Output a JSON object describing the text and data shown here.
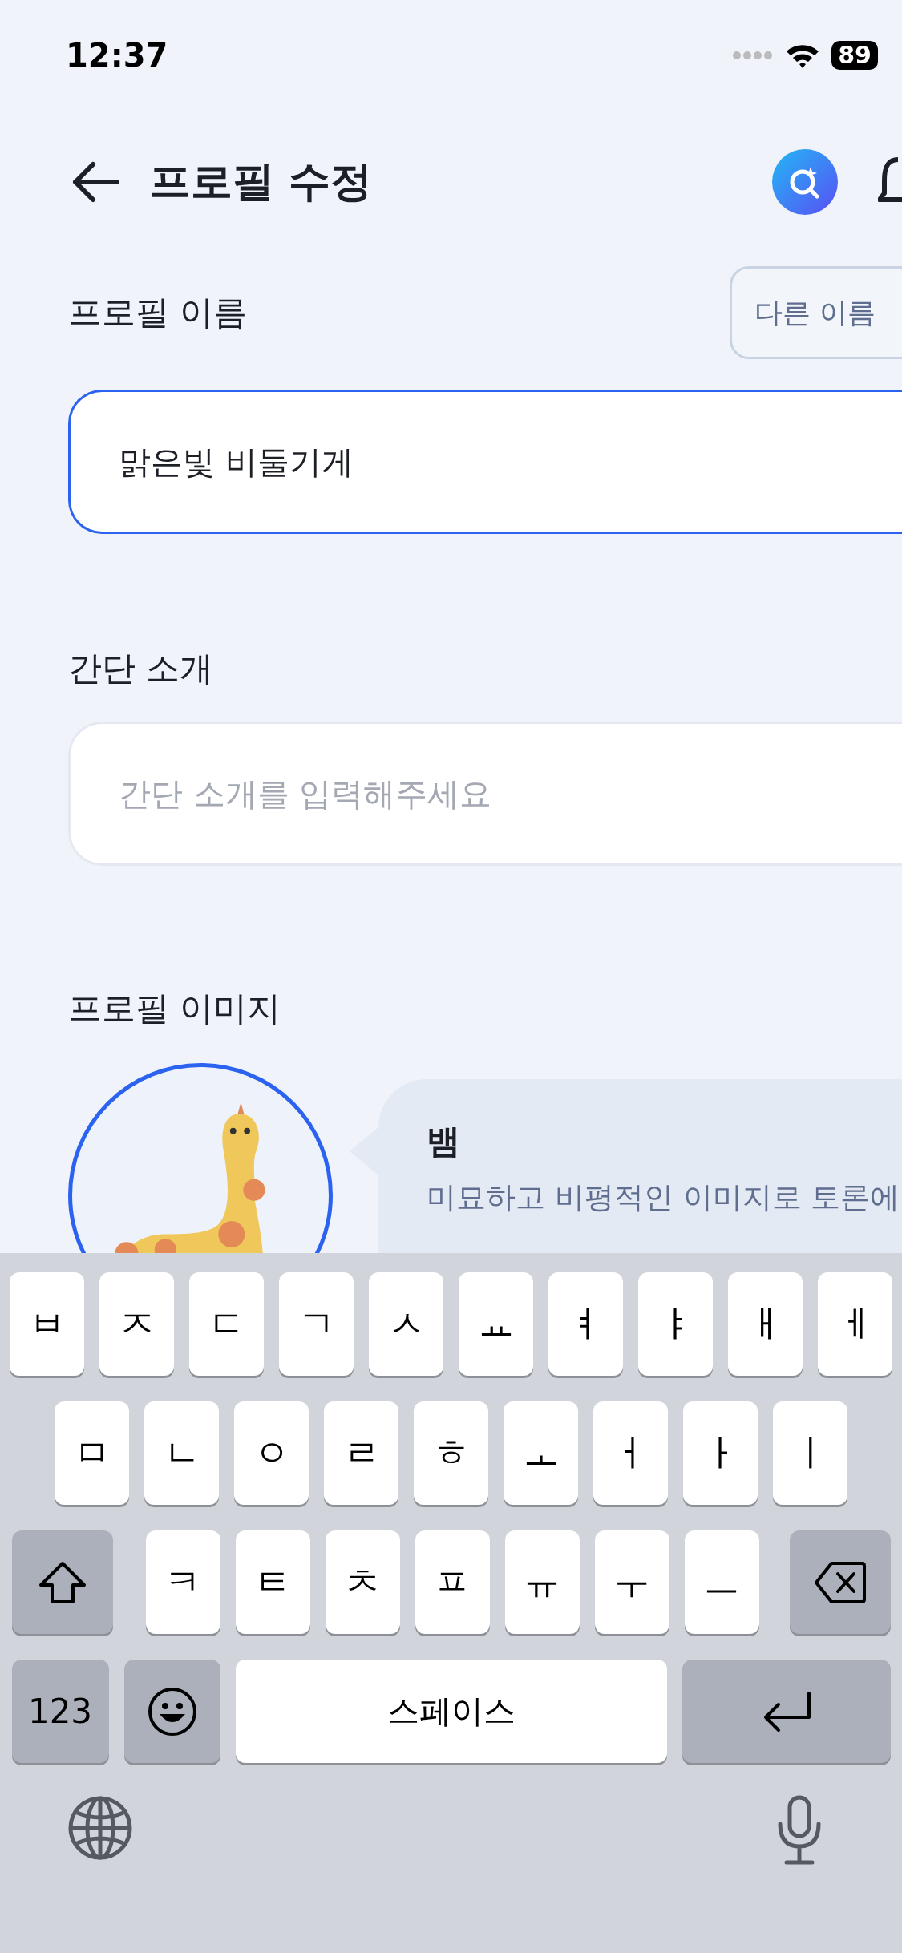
{
  "status_bar": {
    "time": "12:37",
    "battery": "89"
  },
  "header": {
    "title": "프로필 수정"
  },
  "name_section": {
    "label": "프로필 이름",
    "button": "다른 이름",
    "value": "맑은빛 비둘기게",
    "focused": true
  },
  "intro_section": {
    "label": "간단 소개",
    "placeholder": "간단 소개를 입력해주세요"
  },
  "image_section": {
    "label": "프로필 이미지",
    "character_name": "뱀",
    "description": [
      "미묘하고 비평적인 이미지로 토론에"
    ]
  },
  "keyboard": {
    "bottom_row": {
      "numbers_key": "123",
      "space_key": "스페이스"
    },
    "rows": [
      [
        {
          "kind": "letter",
          "label": "ㅂ"
        },
        {
          "kind": "letter",
          "label": "ㅈ"
        },
        {
          "kind": "letter",
          "label": "ㄷ"
        },
        {
          "kind": "letter",
          "label": "ㄱ"
        },
        {
          "kind": "letter",
          "label": "ㅅ"
        },
        {
          "kind": "letter",
          "label": "ㅛ"
        },
        {
          "kind": "letter",
          "label": "ㅕ"
        },
        {
          "kind": "letter",
          "label": "ㅑ"
        },
        {
          "kind": "letter",
          "label": "ㅐ"
        },
        {
          "kind": "letter",
          "label": "ㅔ"
        }
      ],
      [
        {
          "kind": "letter",
          "label": "ㅁ"
        },
        {
          "kind": "letter",
          "label": "ㄴ"
        },
        {
          "kind": "letter",
          "label": "ㅇ"
        },
        {
          "kind": "letter",
          "label": "ㄹ"
        },
        {
          "kind": "letter",
          "label": "ㅎ"
        },
        {
          "kind": "letter",
          "label": "ㅗ"
        },
        {
          "kind": "letter",
          "label": "ㅓ"
        },
        {
          "kind": "letter",
          "label": "ㅏ"
        },
        {
          "kind": "letter",
          "label": "ㅣ"
        }
      ],
      [
        {
          "kind": "shift"
        },
        {
          "kind": "letter",
          "label": "ㅋ"
        },
        {
          "kind": "letter",
          "label": "ㅌ"
        },
        {
          "kind": "letter",
          "label": "ㅊ"
        },
        {
          "kind": "letter",
          "label": "ㅍ"
        },
        {
          "kind": "letter",
          "label": "ㅠ"
        },
        {
          "kind": "letter",
          "label": "ㅜ"
        },
        {
          "kind": "letter",
          "label": "ㅡ"
        },
        {
          "kind": "delete"
        }
      ]
    ]
  }
}
